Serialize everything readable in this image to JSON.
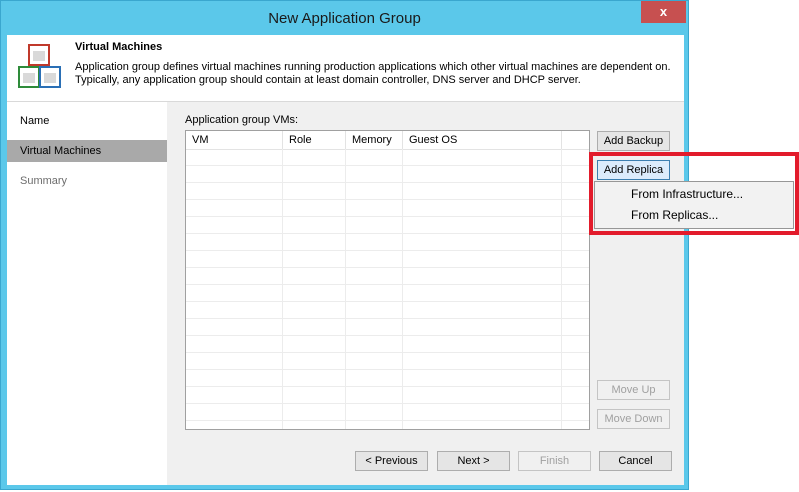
{
  "window": {
    "title": "New Application Group",
    "close_glyph": "x"
  },
  "header": {
    "title": "Virtual Machines",
    "description": "Application group defines virtual machines running production applications which other virtual machines are dependent on. Typically, any application group should contain at least domain controller, DNS server and DHCP server.",
    "icon": "vm-boxes-icon"
  },
  "sidebar": {
    "items": [
      {
        "label": "Name"
      },
      {
        "label": "Virtual Machines"
      },
      {
        "label": "Summary"
      }
    ]
  },
  "main": {
    "grid_label": "Application group VMs:",
    "columns": [
      "VM",
      "Role",
      "Memory",
      "Guest OS"
    ]
  },
  "buttons": {
    "add_backup": "Add Backup",
    "add_replica": "Add Replica",
    "move_up": "Move Up",
    "move_down": "Move Down"
  },
  "menu": {
    "items": [
      "From Infrastructure...",
      "From Replicas..."
    ]
  },
  "footer": {
    "previous": "< Previous",
    "next": "Next >",
    "finish": "Finish",
    "cancel": "Cancel"
  },
  "colors": {
    "title_bar": "#5bc8ea",
    "close_button": "#c75050",
    "highlight_box": "#e21b2b",
    "sidebar_active": "#a9a9a9"
  }
}
